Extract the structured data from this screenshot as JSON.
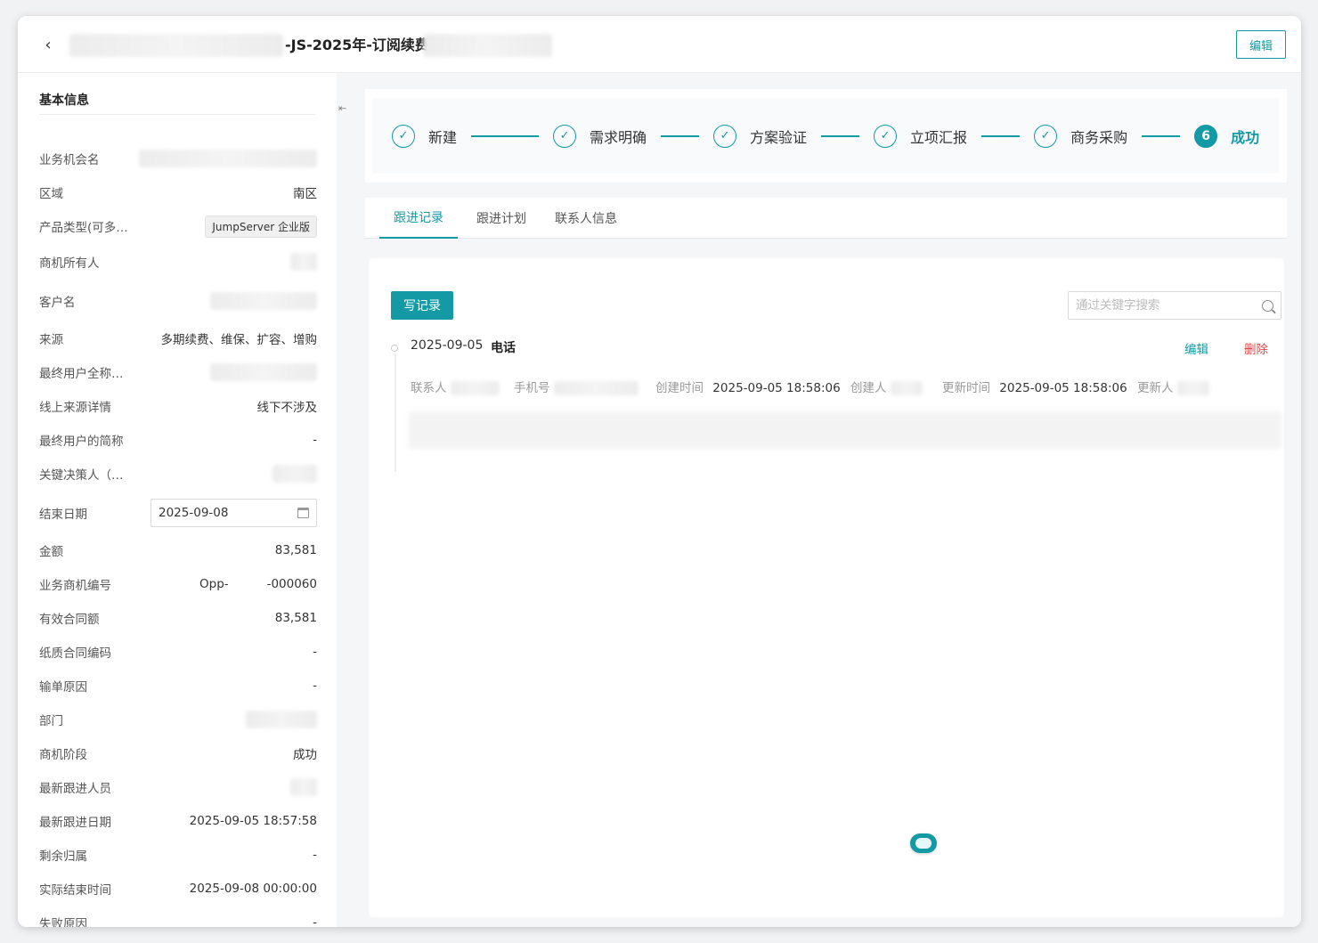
{
  "header": {
    "title": "-JS-2025年-订阅续费",
    "edit_label": "编辑"
  },
  "basic_info": {
    "section_title": "基本信息",
    "fields": [
      {
        "label": "业务机会名",
        "value": ""
      },
      {
        "label": "区域",
        "value": "南区"
      },
      {
        "label": "产品类型(可多…",
        "value": "JumpServer 企业版"
      },
      {
        "label": "商机所有人",
        "value": ""
      },
      {
        "label": "客户名",
        "value": ""
      },
      {
        "label": "来源",
        "value": "多期续费、维保、扩容、增购"
      },
      {
        "label": "最终用户全称…",
        "value": ""
      },
      {
        "label": "线上来源详情",
        "value": "线下不涉及"
      },
      {
        "label": "最终用户的简称",
        "value": "-"
      },
      {
        "label": "关键决策人（…",
        "value": ""
      },
      {
        "label": "结束日期",
        "value": "2025-09-08"
      },
      {
        "label": "金额",
        "value": "83,581"
      },
      {
        "label": "业务商机编号",
        "value": "Opp-          -000060"
      },
      {
        "label": "有效合同额",
        "value": "83,581"
      },
      {
        "label": "纸质合同编码",
        "value": "-"
      },
      {
        "label": "输单原因",
        "value": "-"
      },
      {
        "label": "部门",
        "value": ""
      },
      {
        "label": "商机阶段",
        "value": "成功"
      },
      {
        "label": "最新跟进人员",
        "value": ""
      },
      {
        "label": "最新跟进日期",
        "value": "2025-09-05 18:57:58"
      },
      {
        "label": "剩余归属",
        "value": "-"
      },
      {
        "label": "实际结束时间",
        "value": "2025-09-08 00:00:00"
      },
      {
        "label": "失败原因",
        "value": "-"
      }
    ]
  },
  "stages": {
    "items": [
      {
        "label": "新建",
        "status": "done"
      },
      {
        "label": "需求明确",
        "status": "done"
      },
      {
        "label": "方案验证",
        "status": "done"
      },
      {
        "label": "立项汇报",
        "status": "done"
      },
      {
        "label": "商务采购",
        "status": "done"
      },
      {
        "label": "成功",
        "status": "active",
        "number": "6"
      }
    ]
  },
  "tabs": [
    {
      "label": "跟进记录",
      "active": true
    },
    {
      "label": "跟进计划",
      "active": false
    },
    {
      "label": "联系人信息",
      "active": false
    }
  ],
  "records": {
    "write_label": "写记录",
    "search_placeholder": "通过关键字搜索",
    "items": [
      {
        "date": "2025-09-05",
        "type": "电话",
        "edit": "编辑",
        "delete": "删除",
        "contact_label": "联系人",
        "phone_label": "手机号",
        "created_label": "创建时间",
        "created_value": "2025-09-05 18:58:06",
        "creator_label": "创建人",
        "updated_label": "更新时间",
        "updated_value": "2025-09-05 18:58:06",
        "updater_label": "更新人"
      }
    ]
  },
  "colors": {
    "accent": "#139aa5",
    "danger": "#e04848"
  }
}
